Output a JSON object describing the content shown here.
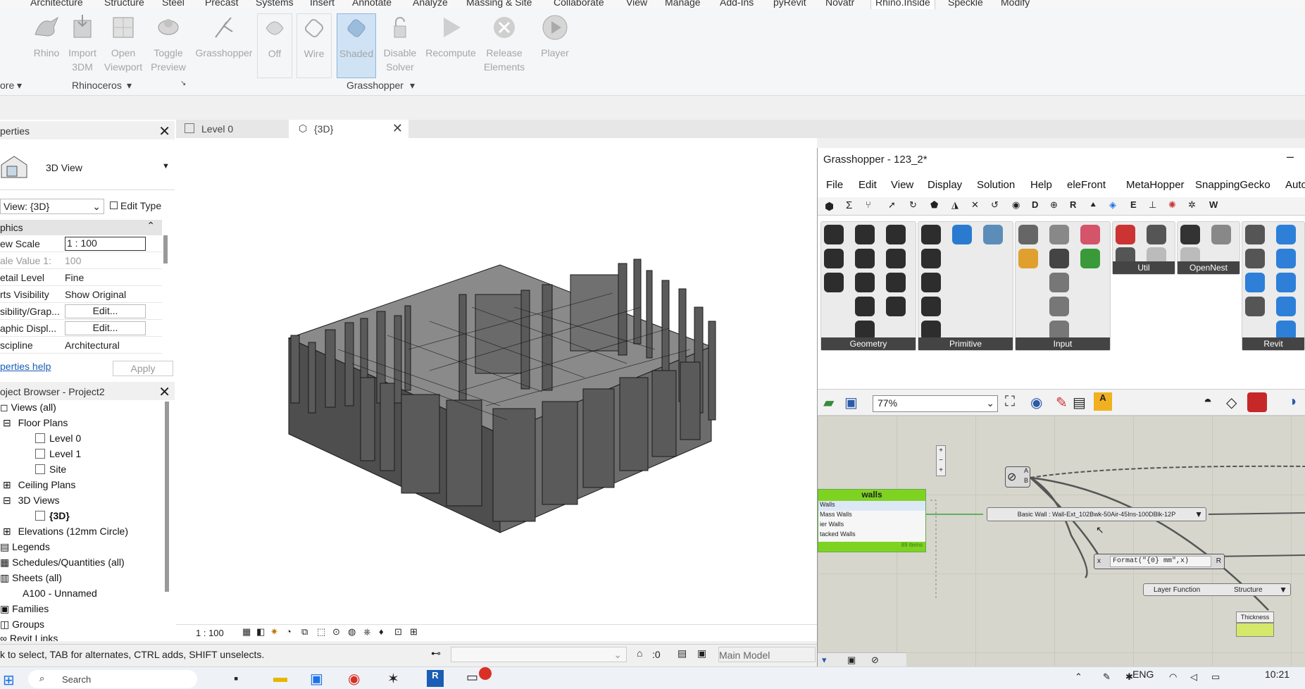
{
  "menubar": {
    "items": [
      "Architecture",
      "Structure",
      "Steel",
      "Precast",
      "Systems",
      "Insert",
      "Annotate",
      "Analyze",
      "Massing & Site",
      "Collaborate",
      "View",
      "Manage",
      "Add-Ins",
      "pyRevit",
      "Novatr",
      "Rhino.Inside",
      "Speckle",
      "Modify"
    ],
    "active": "Rhino.Inside"
  },
  "ribbon": {
    "buttons": [
      {
        "l1": "Rhino",
        "l2": ""
      },
      {
        "l1": "Import",
        "l2": "3DM"
      },
      {
        "l1": "Open",
        "l2": "Viewport"
      },
      {
        "l1": "Toggle",
        "l2": "Preview"
      },
      {
        "l1": "Grasshopper",
        "l2": ""
      },
      {
        "l1": "Off",
        "l2": ""
      },
      {
        "l1": "Wire",
        "l2": ""
      },
      {
        "l1": "Shaded",
        "l2": ""
      },
      {
        "l1": "Disable",
        "l2": "Solver"
      },
      {
        "l1": "Recompute",
        "l2": ""
      },
      {
        "l1": "Release",
        "l2": "Elements"
      },
      {
        "l1": "Player",
        "l2": ""
      }
    ],
    "groups": {
      "more": "ore",
      "rhino": "Rhinoceros",
      "gh": "Grasshopper"
    }
  },
  "properties": {
    "title": "perties",
    "type_name": "3D View",
    "view_selector": "View: {3D}",
    "edit_type": "Edit Type",
    "section": "phics",
    "rows": [
      {
        "k": "ew Scale",
        "v": "1 : 100"
      },
      {
        "k": "ale Value    1:",
        "v": "100"
      },
      {
        "k": "etail Level",
        "v": "Fine"
      },
      {
        "k": "rts Visibility",
        "v": "Show Original"
      },
      {
        "k": "sibility/Grap...",
        "v": "Edit..."
      },
      {
        "k": "aphic Displ...",
        "v": "Edit..."
      },
      {
        "k": "scipline",
        "v": "Architectural"
      }
    ],
    "help": "perties help",
    "apply": "Apply"
  },
  "browser": {
    "title": "oject Browser - Project2",
    "items": [
      "Views (all)",
      "Floor Plans",
      "Level 0",
      "Level 1",
      "Site",
      "Ceiling Plans",
      "3D Views",
      "{3D}",
      "Elevations (12mm Circle)",
      "Legends",
      "Schedules/Quantities (all)",
      "Sheets (all)",
      "A100 - Unnamed",
      "Families",
      "Groups",
      "Revit Links"
    ]
  },
  "tabs": {
    "t1": "Level 0",
    "t2": "{3D}"
  },
  "view": {
    "scale": "1 : 100"
  },
  "status": {
    "hint": "k to select, TAB for alternates, CTRL adds, SHIFT unselects.",
    "count": ":0",
    "model": "Main Model"
  },
  "gh": {
    "title": "Grasshopper - 123_2*",
    "menu": [
      "File",
      "Edit",
      "View",
      "Display",
      "Solution",
      "Help",
      "eleFront",
      "MetaHopper",
      "SnappingGecko",
      "Auto"
    ],
    "tabs": [
      "Σ",
      "D",
      "R",
      "E",
      "W"
    ],
    "groups": [
      "Geometry",
      "Primitive",
      "Input",
      "Util",
      "OpenNest",
      "Revit"
    ],
    "zoom": "77%",
    "nodes": {
      "walls": "walls",
      "list": [
        "Walls",
        "Mass Walls",
        "ier Walls",
        "tacked Walls"
      ],
      "count": "89 items",
      "basic": "Basic Wall : Wall-Ext_102Bwk-50Air-45Ins-100DBlk-12P",
      "format": "Format(\"{0} mm\",x)",
      "layer_fn": "Layer Function",
      "structure": "Structure",
      "thickness": "Thickness",
      "fx": "x",
      "fr": "R",
      "ga": "A",
      "gb": "B"
    }
  },
  "taskbar": {
    "search": "Search",
    "lang": "ENG",
    "time": "10:21"
  }
}
